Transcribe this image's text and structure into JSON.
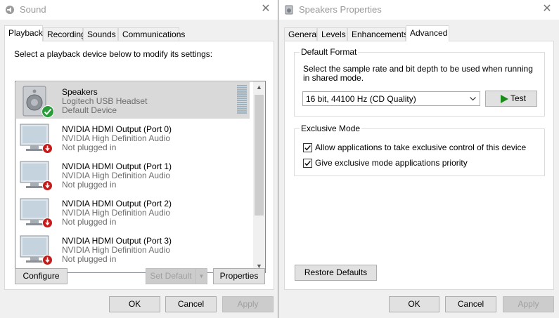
{
  "sound_window": {
    "title": "Sound",
    "tabs": [
      {
        "label": "Playback"
      },
      {
        "label": "Recording"
      },
      {
        "label": "Sounds"
      },
      {
        "label": "Communications"
      }
    ],
    "instruction": "Select a playback device below to modify its settings:",
    "devices": [
      {
        "name": "Speakers",
        "description": "Logitech USB Headset",
        "status": "Default Device"
      },
      {
        "name": "NVIDIA HDMI Output (Port 0)",
        "description": "NVIDIA High Definition Audio",
        "status": "Not plugged in"
      },
      {
        "name": "NVIDIA HDMI Output (Port 1)",
        "description": "NVIDIA High Definition Audio",
        "status": "Not plugged in"
      },
      {
        "name": "NVIDIA HDMI Output (Port 2)",
        "description": "NVIDIA High Definition Audio",
        "status": "Not plugged in"
      },
      {
        "name": "NVIDIA HDMI Output (Port 3)",
        "description": "NVIDIA High Definition Audio",
        "status": "Not plugged in"
      }
    ],
    "buttons": {
      "configure": "Configure",
      "set_default": "Set Default",
      "properties": "Properties",
      "ok": "OK",
      "cancel": "Cancel",
      "apply": "Apply"
    }
  },
  "props_window": {
    "title": "Speakers Properties",
    "tabs": [
      {
        "label": "General"
      },
      {
        "label": "Levels"
      },
      {
        "label": "Enhancements"
      },
      {
        "label": "Advanced"
      }
    ],
    "default_format": {
      "group_label": "Default Format",
      "description": "Select the sample rate and bit depth to be used when running in shared mode.",
      "selected_format": "16 bit, 44100 Hz (CD Quality)",
      "test_label": "Test"
    },
    "exclusive_mode": {
      "group_label": "Exclusive Mode",
      "options": [
        {
          "label": "Allow applications to take exclusive control of this device",
          "checked": true
        },
        {
          "label": "Give exclusive mode applications priority",
          "checked": true
        }
      ]
    },
    "buttons": {
      "restore_defaults": "Restore Defaults",
      "ok": "OK",
      "cancel": "Cancel",
      "apply": "Apply"
    }
  },
  "colors": {
    "selection": "#d9d9d9",
    "check_green": "#2a9d3a",
    "unplugged_red": "#c41a1a",
    "test_play_green": "#1a8a1a"
  }
}
